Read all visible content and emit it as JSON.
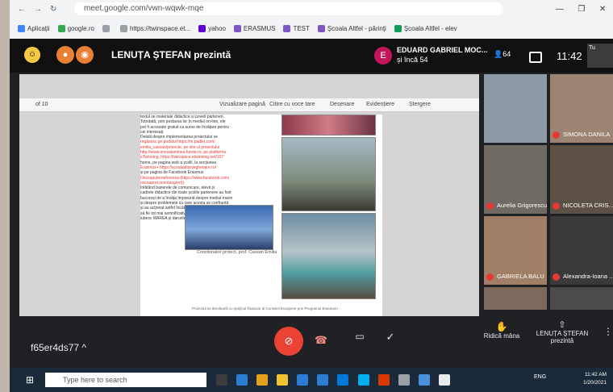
{
  "browser": {
    "url": "meet.google.com/vwn-wqwk-mqe",
    "window_controls": [
      "—",
      "❐",
      "✕"
    ],
    "bookmarks": [
      {
        "label": "Aplicații",
        "color": "#4285f4"
      },
      {
        "label": "google.ro",
        "color": "#34a853"
      },
      {
        "label": "",
        "color": "#9aa0a6"
      },
      {
        "label": "https://twinspace.et...",
        "color": "#9aa0a6"
      },
      {
        "label": "yahoo",
        "color": "#6001d2"
      },
      {
        "label": "ERASMUS",
        "color": "#7e57c2"
      },
      {
        "label": "TEST",
        "color": "#7e57c2"
      },
      {
        "label": "Școala Altfel - părinți",
        "color": "#7e57c2"
      },
      {
        "label": "Școala Altfel - elev",
        "color": "#0f9d58"
      }
    ]
  },
  "meet": {
    "presenter_title": "LENUȚA ȘTEFAN prezintă",
    "pinned_user": {
      "initial": "E",
      "name": "EDUARD GABRIEL MOC...",
      "more": "și încă 54"
    },
    "people_count": "64",
    "time": "11:42",
    "mini_tile_label": "Tu",
    "meeting_code": "f65er4ds77",
    "controls": {
      "raise_hand": "Ridică mâna",
      "presenting": "LENUȚA ȘTEFAN prezintă"
    }
  },
  "shared_doc": {
    "toolbar_items": [
      "Vizualizare pagină",
      "Citire cu voce tare",
      "Desenare",
      "Evidențiere",
      "Ștergere"
    ],
    "lines": [
      {
        "t": "textul se materiale didactice și poveti parteneri.",
        "red": false
      },
      {
        "t": "Totodată, prin postarea lor în mediul on-line, ele",
        "red": false
      },
      {
        "t": "pot fi accesate gratuit ca surse de învățare pentru",
        "red": false
      },
      {
        "t": "cei interesați.",
        "red": false
      },
      {
        "t": "Detalii despre implementarea proiectului se",
        "red": false
      },
      {
        "t": "regăsesc pe podalul https://m.padlet.com/",
        "red": true
      },
      {
        "t": "emilia_cassan/proiecte, pe site-ul proiectului",
        "red": true
      },
      {
        "t": "http://www.oncsaluminea-fuerte.ro, pe platforma",
        "red": true
      },
      {
        "t": "eTwinning, https://twinspace.etwinning.net/107",
        "red": true
      },
      {
        "t": "home, pe pagina web a școlii, la secțiunea",
        "red": false
      },
      {
        "t": "Erasmus+ https://scoalaaltarvegheoare.ro/",
        "red": true
      },
      {
        "t": "și pe pagina de Facebook Erasmus",
        "red": false
      },
      {
        "t": "Oncsaputerneforessa (https://www.facebook.com/",
        "red": true
      },
      {
        "t": "oncsaport.sonotasg/ert)).",
        "red": true
      },
      {
        "t": "Înlătând barierele de comunicare, elevii și",
        "red": false
      },
      {
        "t": "cadrele didactice din toate școlile partenere au fost",
        "red": false
      },
      {
        "t": "bucuroși de a învăța împreună despre mediul marin",
        "red": false
      },
      {
        "t": "și despre problemele cu care acesta se confruntă",
        "red": false
      },
      {
        "t": "și au acționat astfel încât, la finalul acestui proiect,",
        "red": false
      },
      {
        "t": "să fie tot mai semnificativ numărul celor care",
        "red": false
      },
      {
        "t": "iubesc MAREA și darurile ei.",
        "red": false
      }
    ],
    "coordinator": "Coordonator proiect, prof. Cassan Emilia",
    "footnote": "Proiectul se derulează cu sprijinul financiar al Comisiei Europene prin Programul Erasmus+"
  },
  "participants": [
    {
      "name": "",
      "bg": "#8d9aa6"
    },
    {
      "name": "SIMONA DANILA",
      "bg": "#9b8572"
    },
    {
      "name": "Aurelia Grigorescu",
      "bg": "#6f6a63"
    },
    {
      "name": "NICOLETA CRIS...",
      "bg": "#5c5147"
    },
    {
      "name": "GABRIELA BALU",
      "bg": "#a17f66"
    },
    {
      "name": "Alexandra-Ioana ...",
      "bg": "#3a3a3a"
    },
    {
      "name": "",
      "bg": "#7d6a5c"
    },
    {
      "name": "",
      "bg": "#4a4a4a"
    }
  ],
  "taskbar": {
    "search_placeholder": "Type here to search",
    "tray": "ENG",
    "time": "11:42 AM",
    "date": "1/20/2021",
    "icon_colors": [
      "#3c3c3c",
      "#2b7cd3",
      "#e3a21a",
      "#f0c330",
      "#2b7cd3",
      "#2b7cd3",
      "#0078d7",
      "#00aff0",
      "#d83b01",
      "#9aa0a6",
      "#4a90d9",
      "#e8eaed"
    ]
  }
}
